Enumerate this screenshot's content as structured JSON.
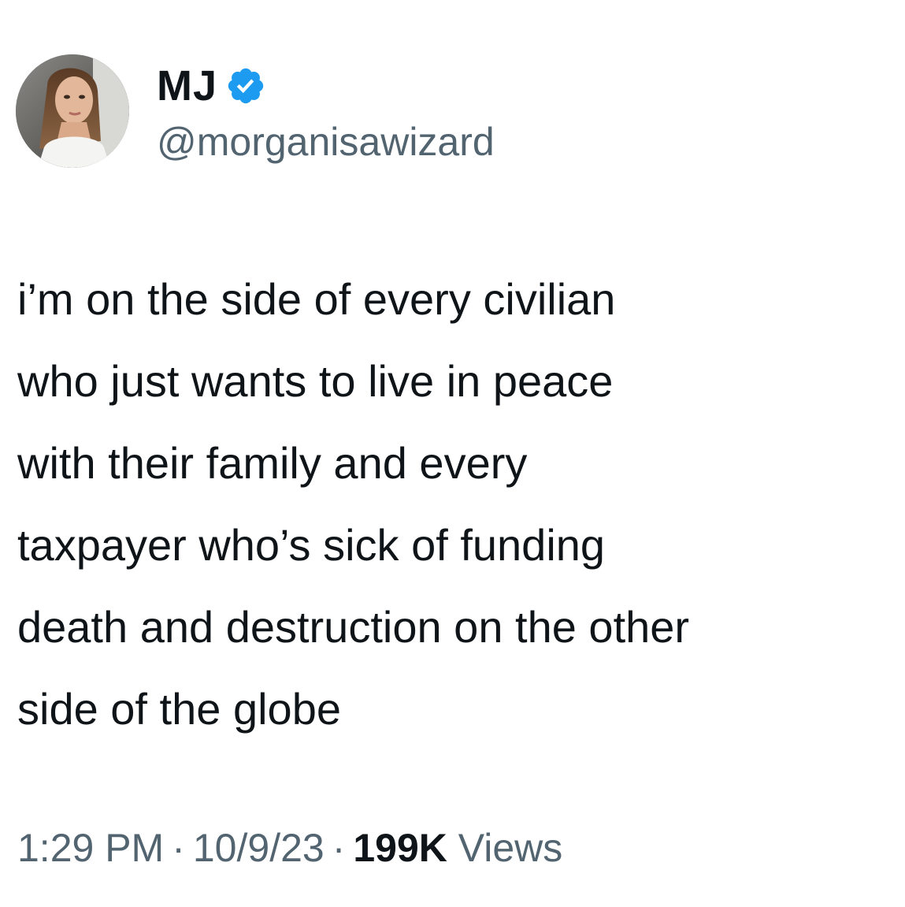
{
  "tweet": {
    "author": {
      "display_name": "MJ",
      "handle": "@morganisawizard",
      "verified": true,
      "verified_color": "#1d9bf0",
      "avatar_icon": "profile-photo"
    },
    "text": "i’m on the side of every civilian\nwho just wants to live in peace\nwith their family and every\ntaxpayer who’s sick of funding\ndeath and destruction on the other\nside of the globe",
    "time": "1:29 PM",
    "date": "10/9/23",
    "separator": "·",
    "views_count": "199K",
    "views_label": "Views"
  },
  "colors": {
    "text_primary": "#0f1419",
    "text_secondary": "#536471",
    "background": "#ffffff"
  }
}
